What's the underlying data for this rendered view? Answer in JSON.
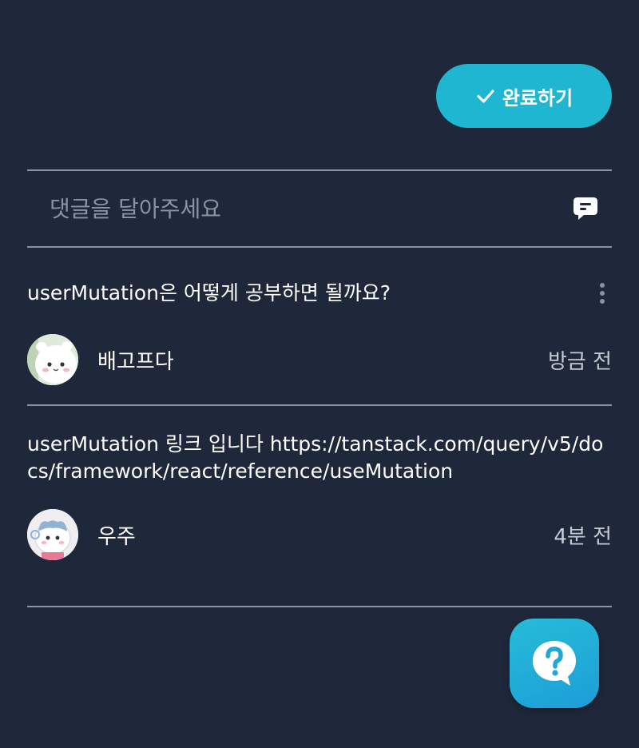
{
  "header": {
    "complete_label": "완료하기"
  },
  "comment_input": {
    "placeholder": "댓글을 달아주세요"
  },
  "comments": [
    {
      "text": "userMutation은 어떻게 공부하면 될까요?",
      "author": "배고프다",
      "time": "방금 전"
    },
    {
      "text": "userMutation 링크 입니다 https://tanstack.com/query/v5/docs/framework/react/reference/useMutation",
      "author": "우주",
      "time": "4분 전"
    }
  ],
  "icons": {
    "complete": "check-icon",
    "send": "chat-bubble-icon",
    "more": "kebab-menu-icon",
    "help": "question-bubble-icon"
  },
  "colors": {
    "background": "#1f283b",
    "accent": "#1fb6d1",
    "divider": "#8a92a3",
    "muted_text": "#c6cad2"
  }
}
